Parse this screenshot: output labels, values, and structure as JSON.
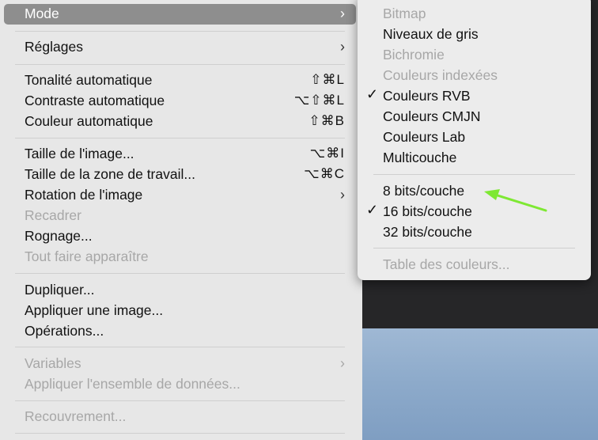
{
  "menu": {
    "items": [
      {
        "label": "Mode",
        "shortcut": "",
        "submenu": true,
        "disabled": false,
        "highlighted": true
      },
      {
        "label": "Réglages",
        "shortcut": "",
        "submenu": true,
        "disabled": false
      },
      {
        "label": "Tonalité automatique",
        "shortcut": "⇧⌘L",
        "submenu": false,
        "disabled": false
      },
      {
        "label": "Contraste automatique",
        "shortcut": "⌥⇧⌘L",
        "submenu": false,
        "disabled": false
      },
      {
        "label": "Couleur automatique",
        "shortcut": "⇧⌘B",
        "submenu": false,
        "disabled": false
      },
      {
        "label": "Taille de l'image...",
        "shortcut": "⌥⌘I",
        "submenu": false,
        "disabled": false
      },
      {
        "label": "Taille de la zone de travail...",
        "shortcut": "⌥⌘C",
        "submenu": false,
        "disabled": false
      },
      {
        "label": "Rotation de l'image",
        "shortcut": "",
        "submenu": true,
        "disabled": false
      },
      {
        "label": "Recadrer",
        "shortcut": "",
        "submenu": false,
        "disabled": true
      },
      {
        "label": "Rognage...",
        "shortcut": "",
        "submenu": false,
        "disabled": false
      },
      {
        "label": "Tout faire apparaître",
        "shortcut": "",
        "submenu": false,
        "disabled": true
      },
      {
        "label": "Dupliquer...",
        "shortcut": "",
        "submenu": false,
        "disabled": false
      },
      {
        "label": "Appliquer une image...",
        "shortcut": "",
        "submenu": false,
        "disabled": false
      },
      {
        "label": "Opérations...",
        "shortcut": "",
        "submenu": false,
        "disabled": false
      },
      {
        "label": "Variables",
        "shortcut": "",
        "submenu": true,
        "disabled": true
      },
      {
        "label": "Appliquer l'ensemble de données...",
        "shortcut": "",
        "submenu": false,
        "disabled": true
      },
      {
        "label": "Recouvrement...",
        "shortcut": "",
        "submenu": false,
        "disabled": true
      }
    ]
  },
  "submenu": {
    "items": [
      {
        "label": "Bitmap",
        "checked": false,
        "disabled": true
      },
      {
        "label": "Niveaux de gris",
        "checked": false,
        "disabled": false
      },
      {
        "label": "Bichromie",
        "checked": false,
        "disabled": true
      },
      {
        "label": "Couleurs indexées",
        "checked": false,
        "disabled": true
      },
      {
        "label": "Couleurs RVB",
        "checked": true,
        "disabled": false
      },
      {
        "label": "Couleurs CMJN",
        "checked": false,
        "disabled": false
      },
      {
        "label": "Couleurs Lab",
        "checked": false,
        "disabled": false
      },
      {
        "label": "Multicouche",
        "checked": false,
        "disabled": false
      },
      {
        "label": "8 bits/couche",
        "checked": false,
        "disabled": false
      },
      {
        "label": "16 bits/couche",
        "checked": true,
        "disabled": false
      },
      {
        "label": "32 bits/couche",
        "checked": false,
        "disabled": false
      },
      {
        "label": "Table des couleurs...",
        "checked": false,
        "disabled": true
      }
    ]
  },
  "glyphs": {
    "chevron": "›",
    "check": "✓"
  },
  "colors": {
    "highlight": "#8e8e8e",
    "annotation_arrow": "#7ee833",
    "disabled_text": "#a7a7a7"
  }
}
